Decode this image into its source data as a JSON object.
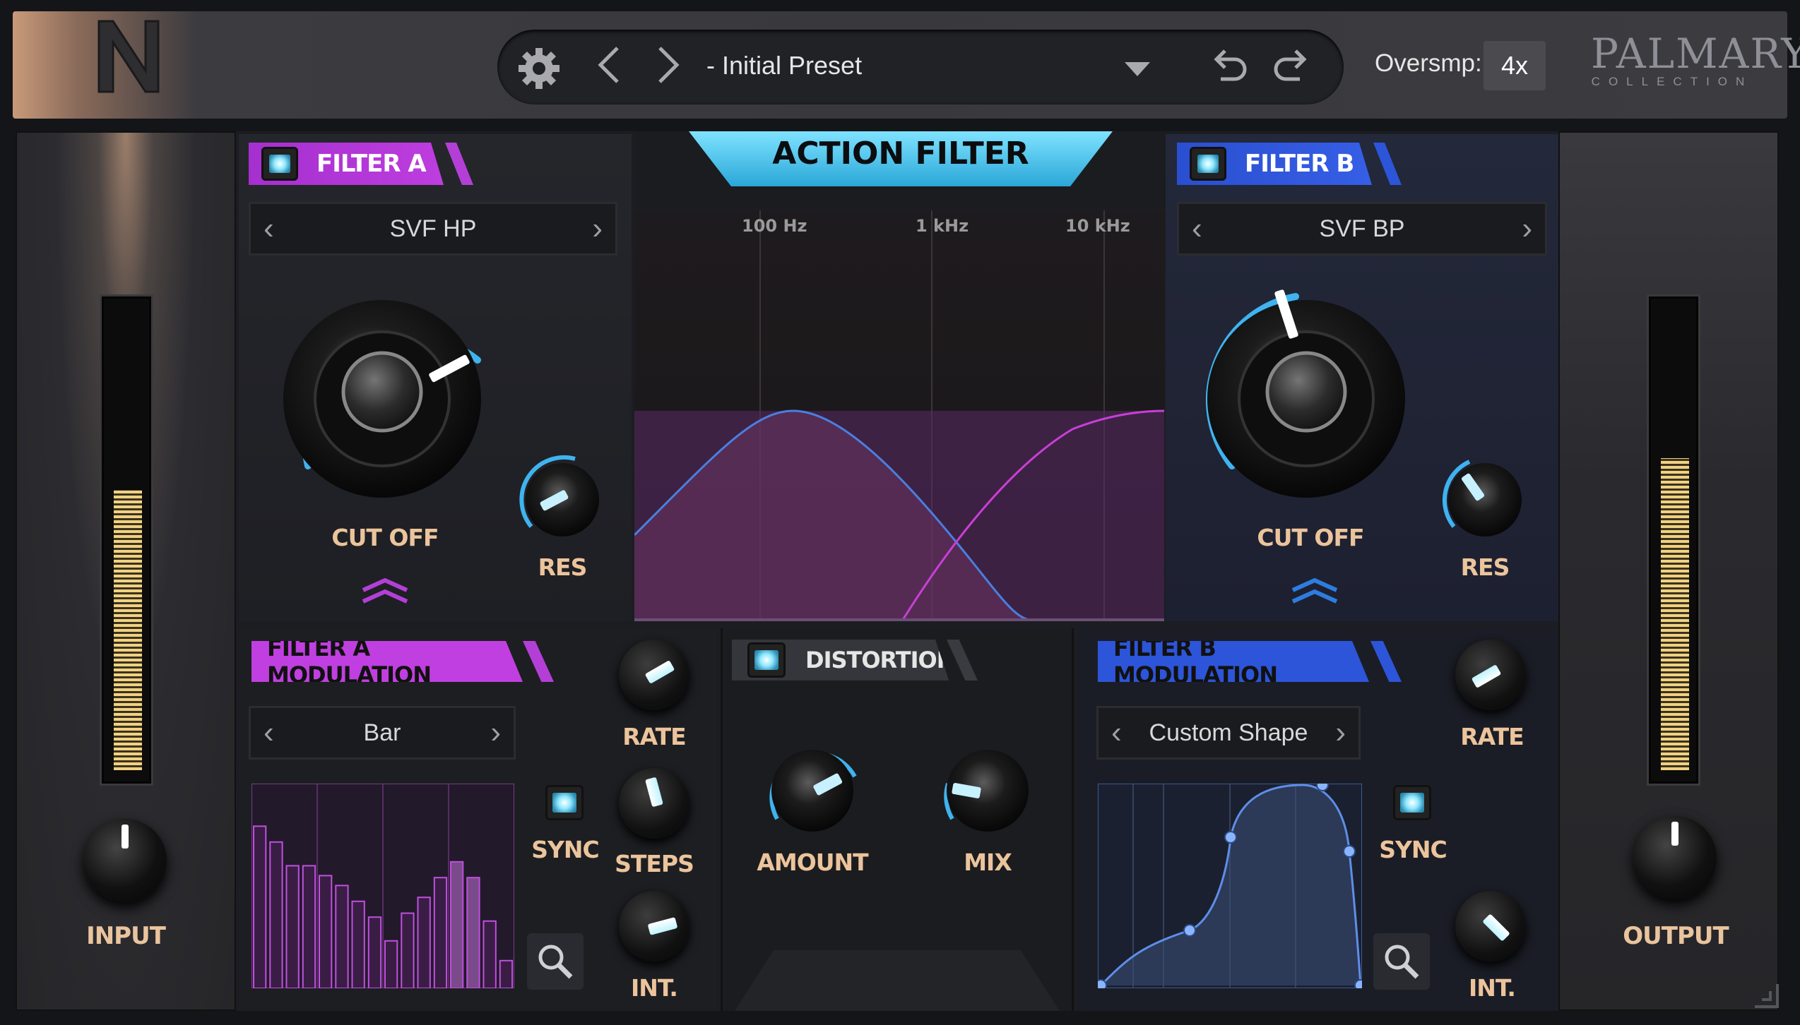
{
  "header": {
    "preset_name": "- Initial Preset",
    "oversample_label": "Oversmp:",
    "oversample_value": "4x",
    "brand_main": "PALMARY",
    "brand_sub": "COLLECTION"
  },
  "input": {
    "label": "INPUT",
    "meter_level": 0.61
  },
  "output": {
    "label": "OUTPUT",
    "meter_level": 0.68
  },
  "title": "ACTION FILTER",
  "filter_a": {
    "tag": "FILTER A",
    "type": "SVF HP",
    "cutoff_label": "CUT OFF",
    "res_label": "RES",
    "color": "#b43fd6"
  },
  "filter_b": {
    "tag": "FILTER B",
    "type": "SVF BP",
    "cutoff_label": "CUT OFF",
    "res_label": "RES",
    "color": "#2d55d9"
  },
  "graph": {
    "freq_labels": [
      "100 Hz",
      "1 kHz",
      "10 kHz"
    ]
  },
  "mod_a": {
    "tag": "FILTER A MODULATION",
    "shape": "Bar",
    "sync_label": "SYNC",
    "rate_label": "RATE",
    "steps_label": "STEPS",
    "int_label": "INT.",
    "bar_values": [
      0.82,
      0.74,
      0.62,
      0.62,
      0.57,
      0.52,
      0.44,
      0.36,
      0.24,
      0.38,
      0.46,
      0.56,
      0.64,
      0.56,
      0.34,
      0.14
    ]
  },
  "distortion": {
    "tag": "DISTORTION",
    "amount_label": "AMOUNT",
    "mix_label": "MIX"
  },
  "mod_b": {
    "tag": "FILTER B MODULATION",
    "shape": "Custom Shape",
    "sync_label": "SYNC",
    "rate_label": "RATE",
    "int_label": "INT."
  }
}
